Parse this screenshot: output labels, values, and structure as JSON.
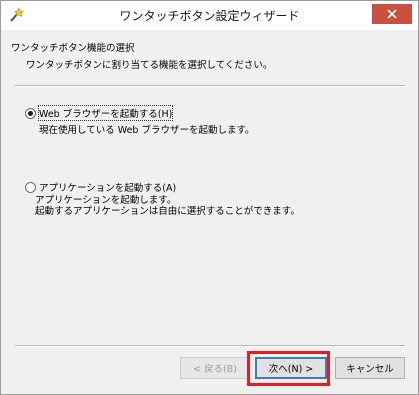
{
  "window": {
    "title": "ワンタッチボタン設定ウィザード",
    "close_icon": "close-icon",
    "app_icon": "wand-icon"
  },
  "header": {
    "title": "ワンタッチボタン機能の選択",
    "description": "ワンタッチボタンに割り当てる機能を選択してください。"
  },
  "options": [
    {
      "label": "Web ブラウザーを起動する(H)",
      "selected": true,
      "descriptions": [
        "現在使用している Web ブラウザーを起動します。"
      ]
    },
    {
      "label": "アプリケーションを起動する(A)",
      "selected": false,
      "descriptions": [
        "アプリケーションを起動します。",
        "起動するアプリケーションは自由に選択することができます。"
      ]
    }
  ],
  "buttons": {
    "back": "< 戻る(B)",
    "next": "次へ(N) >",
    "cancel": "キャンセル"
  },
  "colors": {
    "highlight": "#e02020",
    "close_button": "#c7503f"
  }
}
